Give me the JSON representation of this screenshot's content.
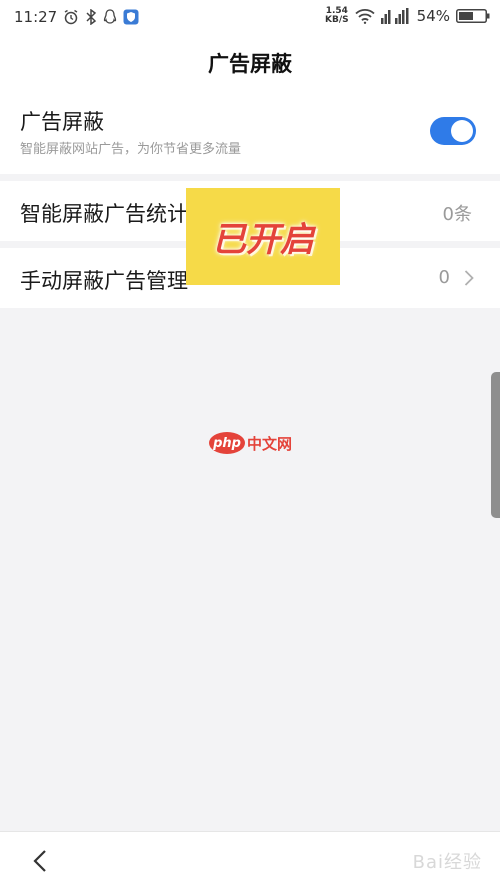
{
  "status_bar": {
    "time": "11:27",
    "net_speed_value": "1.54",
    "net_speed_unit": "KB/S",
    "battery_percent": "54%"
  },
  "header": {
    "title": "广告屏蔽"
  },
  "settings": {
    "ad_block": {
      "title": "广告屏蔽",
      "subtitle": "智能屏蔽网站广告，为你节省更多流量",
      "enabled": true
    },
    "smart_block_stats": {
      "title": "智能屏蔽广告统计",
      "value": "0条"
    },
    "manual_block": {
      "title": "手动屏蔽广告管理",
      "value": "0"
    }
  },
  "overlay": {
    "badge_text": "已开启",
    "watermark_logo": "php",
    "watermark_text": "中文网"
  },
  "bottom_bar": {
    "watermark": "Bai经验"
  },
  "colors": {
    "accent": "#2f7be8",
    "badge_bg": "#f6da48",
    "badge_text": "#e4433a",
    "background": "#f3f3f5"
  },
  "icons": {
    "alarm": "alarm-icon",
    "bluetooth": "bluetooth-icon",
    "qq": "qq-icon",
    "shield_app": "shield-app-icon",
    "wifi": "wifi-icon",
    "signal": "signal-icon",
    "battery": "battery-icon",
    "back": "back-arrow-icon",
    "chevron": "chevron-right-icon"
  }
}
